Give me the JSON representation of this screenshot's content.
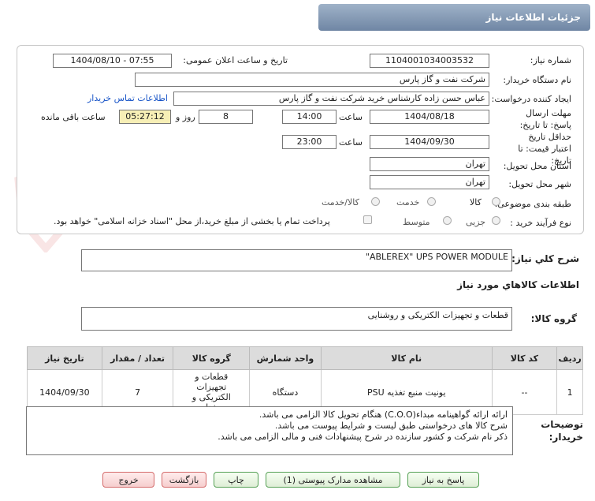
{
  "header": {
    "title": "جزئیات اطلاعات نیاز"
  },
  "form": {
    "need_number_label": "شماره نیاز:",
    "need_number": "1104001034003532",
    "announce_label": "تاریخ و ساعت اعلان عمومی:",
    "announce_value": "1404/08/10 - 07:55",
    "buyer_org_label": "نام دستگاه خریدار:",
    "buyer_org": "شرکت نفت و گاز پارس",
    "creator_label": "ایجاد کننده درخواست:",
    "creator": "عباس حسن زاده کارشناس خرید شرکت نفت و گاز پارس",
    "contact_link": "اطلاعات تماس خریدار",
    "reply_deadline_label": "مهلت ارسال پاسخ: تا تاریخ:",
    "reply_date": "1404/08/18",
    "time_label": "ساعت",
    "reply_time": "14:00",
    "days_value": "8",
    "days_label": "روز و",
    "remaining_time": "05:27:12",
    "remaining_label": "ساعت باقی مانده",
    "validity_label": "حداقل تاریخ اعتبار قیمت: تا تاریخ:",
    "validity_date": "1404/09/30",
    "validity_time": "23:00",
    "province_label": "استان محل تحویل:",
    "province": "تهران",
    "city_label": "شهر محل تحویل:",
    "city": "تهران",
    "category_label": "طبقه بندی موضوعی:",
    "category_options": [
      "کالا",
      "خدمت",
      "کالا/خدمت"
    ],
    "process_label": "نوع فرآیند خرید :",
    "process_options": [
      "جزیی",
      "متوسط"
    ],
    "payment_note": "پرداخت تمام یا بخشی از مبلغ خرید،از محل \"اسناد خزانه اسلامی\" خواهد بود."
  },
  "summary": {
    "label": "شرح کلي نياز:",
    "value": "\"ABLEREX\" UPS POWER MODULE"
  },
  "goods_info_title": "اطلاعات کالاهاي مورد نياز",
  "goods_group": {
    "label": "گروه کالا:",
    "value": "قطعات و تجهیزات الکتریکی و روشنایی"
  },
  "table": {
    "headers": [
      "ردیف",
      "کد کالا",
      "نام کالا",
      "واحد شمارش",
      "گروه کالا",
      "تعداد / مقدار",
      "تاریخ نیاز"
    ],
    "rows": [
      [
        "1",
        "--",
        "یونیت منبع تغذیه PSU",
        "دستگاه",
        "قطعات و تجهیزات الکتریکی و روشنایی",
        "7",
        "1404/09/30"
      ]
    ]
  },
  "buyer_notes": {
    "label": "توضیحات خریدار:",
    "lines": [
      "ارائه ارائه گواهینامه مبداء(C.O.O) هنگام تحویل کالا الزامی می باشد.",
      "شرح کالا های درخواستی طبق لیست و شرایط پیوست می باشد.",
      "ذکر نام شرکت و کشور سازنده در شرح پیشنهادات فنی و مالی الزامی می باشد."
    ]
  },
  "buttons": {
    "reply": "پاسخ به نیاز",
    "attachments": "مشاهده مدارک پیوستی (1)",
    "print": "چاپ",
    "back": "بازگشت",
    "exit": "خروج"
  },
  "watermark": "AriaTender.net",
  "colors": {
    "header": "#7f95b1",
    "link": "#1a56c8",
    "yellow": "#f7efb6",
    "green_border": "#55a055",
    "red_border": "#d46a6a"
  }
}
